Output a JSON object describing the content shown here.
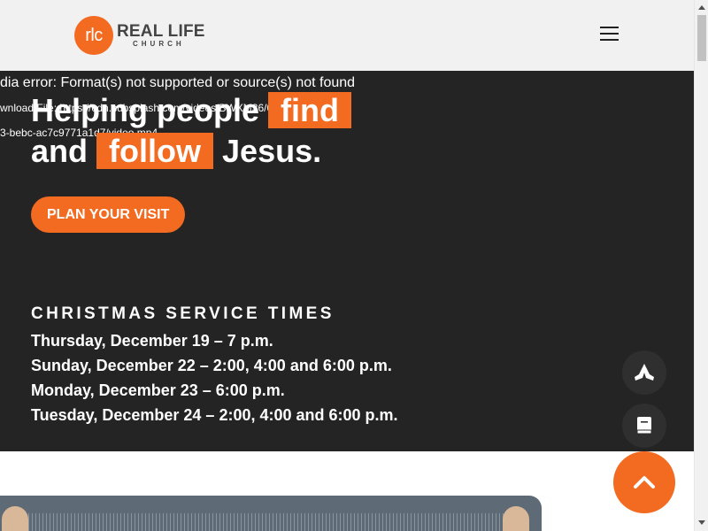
{
  "header": {
    "logo_mark": "rlc",
    "logo_main": "REAL LIFE",
    "logo_sub": "CHURCH",
    "menu_icon": "hamburger-icon"
  },
  "hero": {
    "media_error": "dia error: Format(s) not supported or source(s) not found",
    "media_link_1": "wnload File: https://cdn.subsplash.com/videos/BWXM36/0349",
    "media_link_2": "3-bebc-ac7c9771a1d7/video.mp4",
    "headline": {
      "part1": "Helping people",
      "highlight1": "find",
      "part2": "and",
      "highlight2": "follow",
      "part3": "Jesus."
    },
    "cta_label": "PLAN YOUR VISIT",
    "service_title": "CHRISTMAS SERVICE TIMES",
    "services": [
      "Thursday, December 19 – 7 p.m.",
      "Sunday, December 22 – 2:00, 4:00 and 6:00 p.m.",
      "Monday, December 23 – 6:00 p.m.",
      "Tuesday, December 24 – 2:00, 4:00 and 6:00 p.m."
    ]
  },
  "floating": {
    "pray_icon": "praying-hands-icon",
    "bible_icon": "bible-icon",
    "top_icon": "chevron-up-icon"
  },
  "colors": {
    "accent": "#f26b21",
    "hero_bg": "#242424",
    "header_bg": "#f1f1f1"
  }
}
